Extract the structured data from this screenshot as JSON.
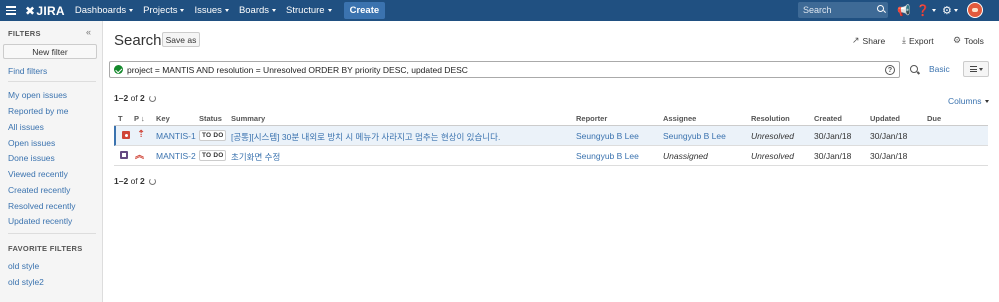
{
  "topbar": {
    "brand": "JIRA",
    "nav": [
      "Dashboards",
      "Projects",
      "Issues",
      "Boards",
      "Structure"
    ],
    "create": "Create",
    "search_placeholder": "Search"
  },
  "sidebar": {
    "heading": "FILTERS",
    "new_filter": "New filter",
    "find_filters": "Find filters",
    "items": [
      "My open issues",
      "Reported by me",
      "All issues",
      "Open issues",
      "Done issues",
      "Viewed recently",
      "Created recently",
      "Resolved recently",
      "Updated recently"
    ],
    "favorites_heading": "FAVORITE FILTERS",
    "favorites": [
      "old style",
      "old style2"
    ]
  },
  "main": {
    "title": "Search",
    "save_as": "Save as",
    "share": "Share",
    "export": "Export",
    "tools": "Tools",
    "jql": "project = MANTIS AND resolution = Unresolved ORDER BY priority DESC, updated DESC",
    "help": "?",
    "basic": "Basic",
    "count_range": "1–2",
    "count_of": "of",
    "count_total": "2",
    "columns": "Columns"
  },
  "table": {
    "headers": {
      "t": "T",
      "p": "P",
      "key": "Key",
      "status": "Status",
      "summary": "Summary",
      "reporter": "Reporter",
      "assignee": "Assignee",
      "resolution": "Resolution",
      "created": "Created",
      "updated": "Updated",
      "due": "Due"
    },
    "rows": [
      {
        "type": "bug",
        "priority": "highest",
        "key": "MANTIS-1",
        "status": "TO DO",
        "summary": "[공통][시스템] 30분 내외로 방치 시 메뉴가 사라지고 멈추는 현상이 있습니다.",
        "reporter": "Seungyub B Lee",
        "assignee": "Seungyub B Lee",
        "resolution": "Unresolved",
        "created": "30/Jan/18",
        "updated": "30/Jan/18",
        "due": ""
      },
      {
        "type": "epic",
        "priority": "high",
        "key": "MANTIS-2",
        "status": "TO DO",
        "summary": "초기화면 수정",
        "reporter": "Seungyub B Lee",
        "assignee": "Unassigned",
        "resolution": "Unresolved",
        "created": "30/Jan/18",
        "updated": "30/Jan/18",
        "due": ""
      }
    ]
  },
  "colors": {
    "header": "#205081",
    "link": "#3b73af",
    "create": "#3b73af",
    "bug": "#d04437",
    "epic": "#654982"
  }
}
